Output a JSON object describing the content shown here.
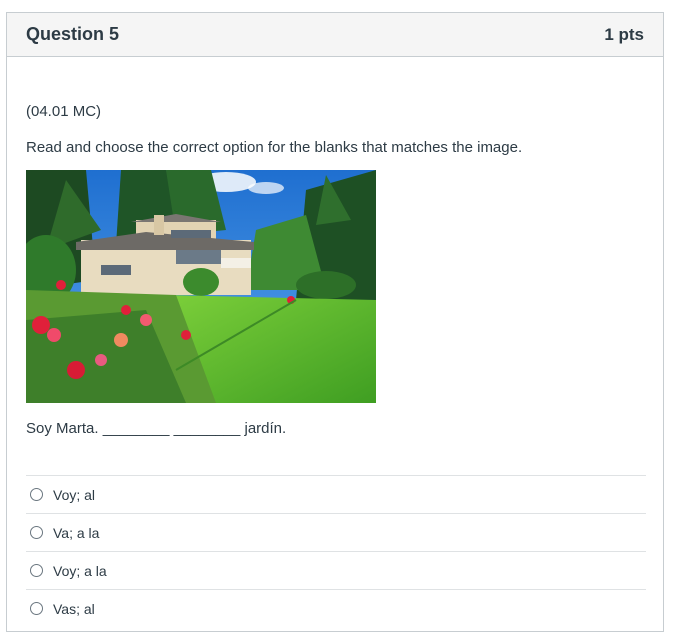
{
  "question": {
    "title": "Question 5",
    "points": "1 pts",
    "code": "(04.01 MC)",
    "prompt": "Read and choose the correct option for the blanks that matches the image.",
    "sentence": "Soy Marta. ________ ________ jardín."
  },
  "image": {
    "subject": "house-with-garden-photo",
    "colors": {
      "sky": "#2d7fd8",
      "lawn": "#5cbf2a",
      "trees": "#1f4f24",
      "flowers": "#e0203a",
      "house": "#e8dcc0"
    }
  },
  "answers": [
    {
      "label": "Voy; al"
    },
    {
      "label": "Va; a la"
    },
    {
      "label": "Voy; a la"
    },
    {
      "label": "Vas; al"
    }
  ]
}
